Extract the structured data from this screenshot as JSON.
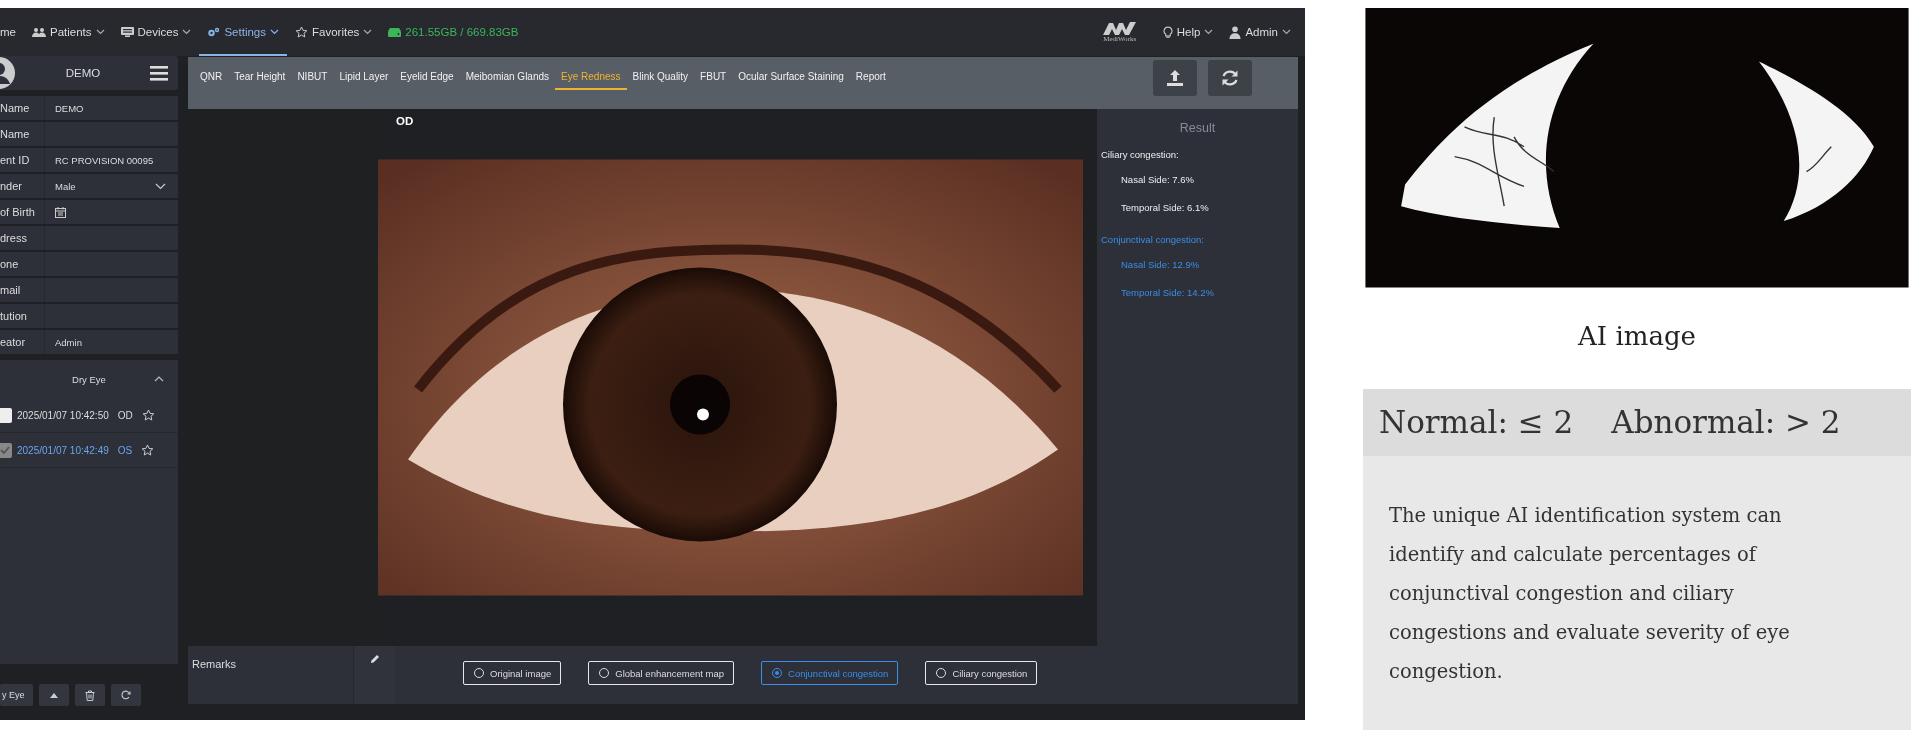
{
  "nav": {
    "items": [
      {
        "label": "me",
        "caret": false,
        "selected": false
      },
      {
        "label": "Patients",
        "caret": true,
        "selected": false
      },
      {
        "label": "Devices",
        "caret": true,
        "selected": false
      },
      {
        "label": "Settings",
        "caret": true,
        "selected": true
      },
      {
        "label": "Favorites",
        "caret": true,
        "selected": false
      }
    ],
    "storage": "261.55GB / 669.83GB",
    "logo_text": "MediWorks",
    "right_items": [
      {
        "label": "Help"
      },
      {
        "label": "Admin"
      }
    ]
  },
  "sidebar": {
    "patient_name": "DEMO",
    "fields": [
      {
        "label": "Name",
        "value": "DEMO",
        "kind": "text"
      },
      {
        "label": "Name",
        "kind": "text"
      },
      {
        "label": "ent ID",
        "value": "RC PROVISION 00095",
        "kind": "text"
      },
      {
        "label": "nder",
        "value": "Male",
        "kind": "select"
      },
      {
        "label": "of Birth",
        "kind": "date"
      },
      {
        "label": "dress",
        "kind": "text"
      },
      {
        "label": "one",
        "kind": "text"
      },
      {
        "label": "mail",
        "kind": "text"
      },
      {
        "label": "tution",
        "kind": "text"
      },
      {
        "label": "eator",
        "value": "Admin",
        "kind": "text"
      }
    ],
    "records": {
      "title": "Dry Eye",
      "expanded": true,
      "items": [
        {
          "time": "2025/01/07 10:42:50",
          "eye": "OD",
          "checked": false,
          "selected": false
        },
        {
          "time": "2025/01/07 10:42:49",
          "eye": "OS",
          "checked": true,
          "selected": true
        }
      ]
    },
    "footer_button": "y Eye"
  },
  "tabs": [
    {
      "label": "QNR",
      "selected": false
    },
    {
      "label": "Tear Height",
      "selected": false
    },
    {
      "label": "NIBUT",
      "selected": false
    },
    {
      "label": "Lipid Layer",
      "selected": false
    },
    {
      "label": "Eyelid Edge",
      "selected": false
    },
    {
      "label": "Meibomian Glands",
      "selected": false
    },
    {
      "label": "Eye Redness",
      "selected": true
    },
    {
      "label": "Blink Quality",
      "selected": false
    },
    {
      "label": "FBUT",
      "selected": false
    },
    {
      "label": "Ocular Surface Staining",
      "selected": false
    },
    {
      "label": "Report",
      "selected": false
    }
  ],
  "image_label": "OD",
  "result": {
    "title": "Result",
    "groups": [
      {
        "title": "Ciliary congestion:",
        "selected": false,
        "items": [
          "Nasal Side: 7.6%",
          "Temporal Side: 6.1%"
        ]
      },
      {
        "title": "Conjunctival congestion:",
        "selected": true,
        "items": [
          "Nasal Side: 12.9%",
          "Temporal Side: 14.2%"
        ]
      }
    ]
  },
  "remarks": {
    "label": "Remarks"
  },
  "view_options": [
    {
      "label": "Original image",
      "selected": false
    },
    {
      "label": "Global enhancement map",
      "selected": false
    },
    {
      "label": "Conjunctival congestion",
      "selected": true
    },
    {
      "label": "Ciliary congestion",
      "selected": false
    }
  ],
  "promo": {
    "caption": "AI image",
    "normal": "Normal: ≤ 2",
    "abnormal": "Abnormal: > 2",
    "description": "The unique AI identification system can identify and calculate percentages of conjunctival  congestion  and ciliary congestions and evaluate severity of eye congestion."
  }
}
